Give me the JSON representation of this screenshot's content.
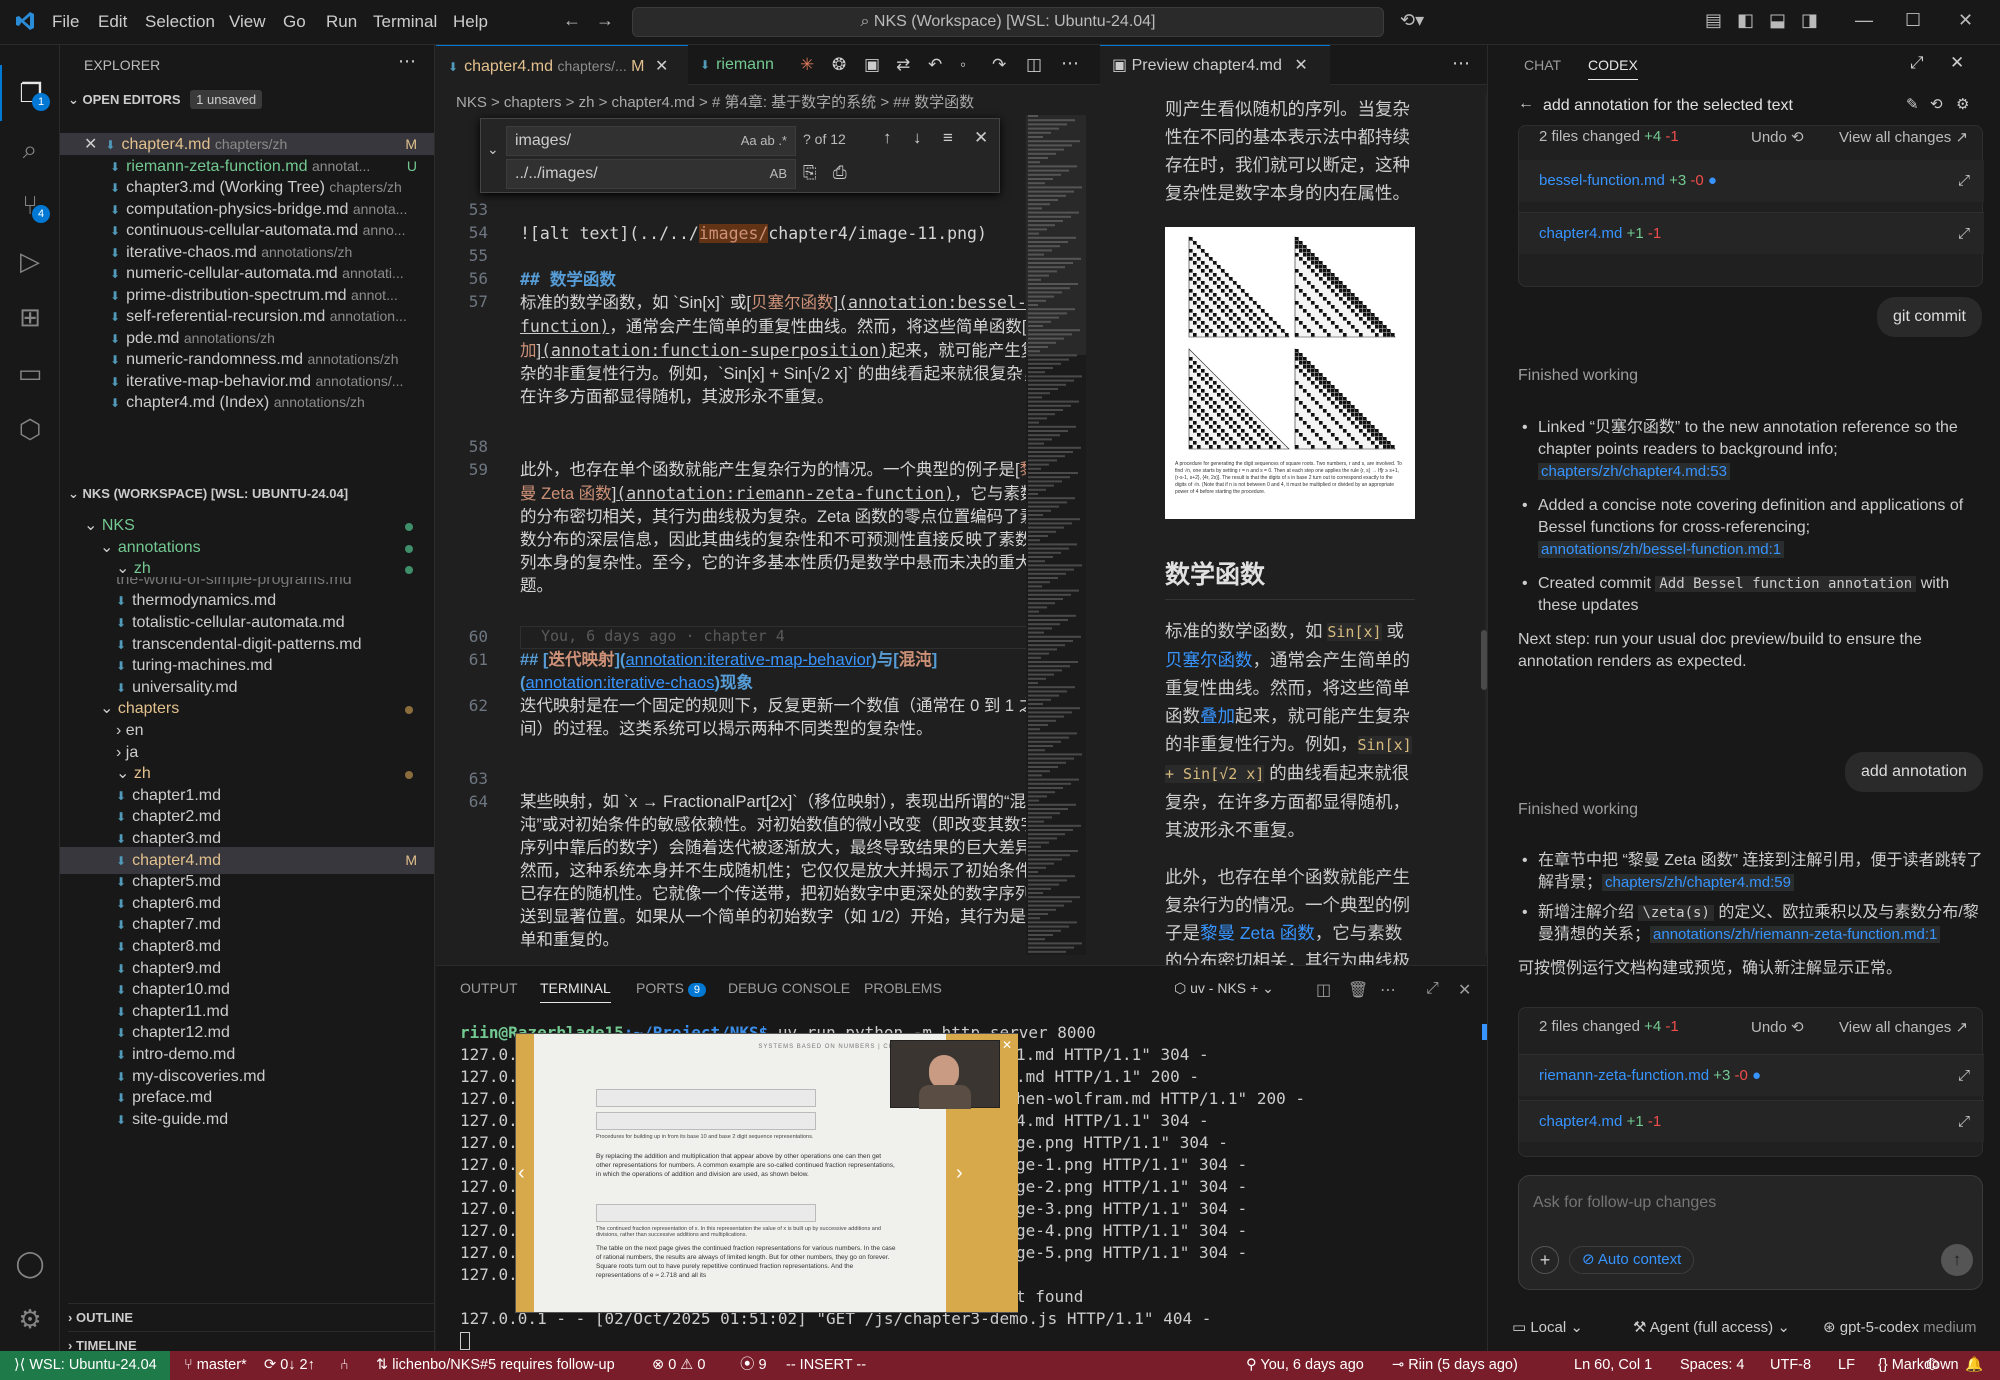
{
  "title_bar": {
    "menu": [
      "File",
      "Edit",
      "Selection",
      "View",
      "Go",
      "Run",
      "Terminal",
      "Help"
    ],
    "command_center": "NKS (Workspace) [WSL: Ubuntu-24.04]"
  },
  "activity_bar": {
    "explorer_badge": "1",
    "scm_badge": "4"
  },
  "explorer": {
    "title": "EXPLORER",
    "open_editors_label": "OPEN EDITORS",
    "unsaved_badge": "1 unsaved",
    "open_editors": [
      {
        "name": "chapter4.md",
        "desc": "chapters/zh",
        "status": "M"
      },
      {
        "name": "riemann-zeta-function.md",
        "desc": "annotat...",
        "status": "U"
      },
      {
        "name": "chapter3.md (Working Tree)",
        "desc": "chapters/zh",
        "status": ""
      },
      {
        "name": "computation-physics-bridge.md",
        "desc": "annota...",
        "status": ""
      },
      {
        "name": "continuous-cellular-automata.md",
        "desc": "anno...",
        "status": ""
      },
      {
        "name": "iterative-chaos.md",
        "desc": "annotations/zh",
        "status": ""
      },
      {
        "name": "numeric-cellular-automata.md",
        "desc": "annotati...",
        "status": ""
      },
      {
        "name": "prime-distribution-spectrum.md",
        "desc": "annot...",
        "status": ""
      },
      {
        "name": "self-referential-recursion.md",
        "desc": "annotation...",
        "status": ""
      },
      {
        "name": "pde.md",
        "desc": "annotations/zh",
        "status": ""
      },
      {
        "name": "numeric-randomness.md",
        "desc": "annotations/zh",
        "status": ""
      },
      {
        "name": "iterative-map-behavior.md",
        "desc": "annotations/...",
        "status": ""
      },
      {
        "name": "chapter4.md (Index)",
        "desc": "annotations/zh",
        "status": ""
      }
    ],
    "workspace_label": "NKS (WORKSPACE) [WSL: UBUNTU-24.04]",
    "tree_top": [
      {
        "name": "NKS",
        "indent": 1
      },
      {
        "name": "annotations",
        "indent": 2
      },
      {
        "name": "zh",
        "indent": 3
      }
    ],
    "cut_off": "the-world-of-simple-programs.md",
    "annotation_files": [
      "thermodynamics.md",
      "totalistic-cellular-automata.md",
      "transcendental-digit-patterns.md",
      "turing-machines.md",
      "universality.md"
    ],
    "chapters_label": "chapters",
    "lang_folders": [
      "en",
      "ja",
      "zh"
    ],
    "chapter_files": [
      "chapter1.md",
      "chapter2.md",
      "chapter3.md",
      "chapter4.md",
      "chapter5.md",
      "chapter6.md",
      "chapter7.md",
      "chapter8.md",
      "chapter9.md",
      "chapter10.md",
      "chapter11.md",
      "chapter12.md",
      "intro-demo.md",
      "my-discoveries.md",
      "preface.md",
      "site-guide.md"
    ],
    "chapter4_status": "M",
    "outline_label": "OUTLINE",
    "timeline_label": "TIMELINE"
  },
  "editor": {
    "tab1_name": "chapter4.md",
    "tab1_desc": "chapters/...",
    "tab1_status": "M",
    "tab2_name": "riemann",
    "breadcrumb": "NKS  >  chapters  >  zh  >  chapter4.md  >  # 第4章: 基于数字的系统  >  ## 数学函数",
    "find_value": "images/",
    "find_count": "? of 12",
    "replace_value": "../../images/",
    "line_numbers": [
      "53",
      "54",
      "55",
      "56",
      "57",
      "58",
      "59",
      "60",
      "61",
      "62",
      "63",
      "64"
    ],
    "line54_prefix": "![alt text](../../",
    "line54_match": "images/",
    "line54_suffix": "chapter4/image-11.png)",
    "line56_hash": "## ",
    "line56_title": "数学函数",
    "line57_a": "标准的数学函数，如 `Sin[x]` 或[",
    "line57_link": "贝塞尔函数",
    "line57_b": "]",
    "line57_ann1": "(annotation:bessel-function)",
    "line57_c": "，通常会产生简单的重复性曲线。然而，将这些简单函数[",
    "line57_link2": "叠加",
    "line57_d": "]",
    "line57_ann2": "(annotation:function-superposition)",
    "line57_e": "起来，就可能产生复杂的非重复性行为。例如，`Sin[x] + Sin[√2 x]` 的曲线看起来就很复杂，在许多方面都显得随机，其波形永不重复。",
    "line59_a": "此外，也存在单个函数就能产生复杂行为的情况。一个典型的例子是[",
    "line59_link": "黎曼 Zeta 函数",
    "line59_b": "]",
    "line59_ann": "(annotation:riemann-zeta-function)",
    "line59_c": "，它与素数的分布密切相关，其行为曲线极为复杂。Zeta 函数的零点位置编码了素数分布的深层信息，因此其曲线的复杂性和不可预测性直接反映了素数序列本身的复杂性。至今，它的许多基本性质仍是数学中悬而未决的重大难题。",
    "blame": "You, 6 days ago · chapter 4",
    "line61_a": "## [",
    "line61_t1": "迭代映射",
    "line61_b": "](",
    "line61_u1": "annotation:iterative-map-behavior",
    "line61_c": ")与[",
    "line61_t2": "混沌",
    "line61_d": "](",
    "line61_u2": "annotation:iterative-chaos",
    "line61_e": ")现象",
    "line62": "迭代映射是在一个固定的规则下，反复更新一个数值（通常在 0 到 1 之间）的过程。这类系统可以揭示两种不同类型的复杂性。",
    "line64": "某些映射，如 `x → FractionalPart[2x]`（移位映射），表现出所谓的“混沌”或对初始条件的敏感依赖性。对初始数值的微小改变（即改变其数字序列中靠后的数字）会随着迭代被逐渐放大，最终导致结果的巨大差异。然而，这种系统本身并不生成随机性；它仅仅是放大并揭示了初始条件中已存在的随机性。它就像一个传送带，把初始数字中更深处的数字序列输送到显著位置。如果从一个简单的初始数字（如 1/2）开始，其行为是简单和重复的。"
  },
  "preview": {
    "tab_name": "Preview chapter4.md",
    "para_top": "则产生看似随机的序列。当复杂性在不同的基本表示法中都持续存在时，我们就可以断定，这种复杂性是数字本身的内在属性。",
    "figure_caption": "A procedure for generating the digit sequences of square roots. Two numbers, r and s, are involved. To find √n, one starts by setting r = n and s = 0. Then at each step one applies the rule {r, s} → If[r ≥ s+1, {r-s-1, s+2}, {4r, 2s}]. The result is that the digits of s in base 2 turn out to correspond exactly to the digits of √n. (Note that if n is not between 0 and 4, it must be multiplied or divided by an appropriate power of 4 before starting the procedure.",
    "heading": "数学函数",
    "p1_a": "标准的数学函数，如 ",
    "p1_code1": "Sin[x]",
    "p1_b": " 或",
    "p1_link": "贝塞尔函数",
    "p1_c": "，通常会产生简单的重复性曲线。然而，将这些简单函数",
    "p1_link2": "叠加",
    "p1_d": "起来，就可能产生复杂的非重复性行为。例如，",
    "p1_code2": "Sin[x] + Sin[√2 x]",
    "p1_e": " 的曲线看起来就很复杂，在许多方面都显得随机，其波形永不重复。",
    "p2_a": "此外，也存在单个函数就能产生复杂行为的情况。一个典型的例子是",
    "p2_link": "黎曼 Zeta 函数",
    "p2_b": "，它与素数的分布密切相关，其行为曲线极"
  },
  "panel": {
    "tabs": [
      "OUTPUT",
      "TERMINAL",
      "PORTS",
      "DEBUG CONSOLE",
      "PROBLEMS"
    ],
    "ports_badge": "9",
    "terminal_name": "uv - NKS",
    "prompt_user": "riin@Razerblade15",
    "prompt_path": ":~/Project/NKS$",
    "prompt_cmd": " uv run python -m http.server 8000",
    "lines_left": [
      "127.0.",
      "127.0.",
      "127.0.",
      "127.0.",
      "127.0.",
      "127.0.",
      "127.0.",
      "127.0.",
      "127.0.",
      "127.0.",
      "127.0."
    ],
    "lines_right": [
      "1.md HTTP/1.1\" 304 -",
      ".md HTTP/1.1\" 200 -",
      "hen-wolfram.md HTTP/1.1\" 200 -",
      "4.md HTTP/1.1\" 304 -",
      "ge.png HTTP/1.1\" 304 -",
      "ge-1.png HTTP/1.1\" 304 -",
      "ge-2.png HTTP/1.1\" 304 -",
      "ge-3.png HTTP/1.1\" 304 -",
      "ge-4.png HTTP/1.1\" 304 -",
      "ge-5.png HTTP/1.1\" 304 -",
      ""
    ],
    "notfound": "t found",
    "last_line": "127.0.0.1 - - [02/Oct/2025 01:51:02] \"GET /js/chapter3-demo.js HTTP/1.1\" 404 -",
    "video_header": "SYSTEMS BASED ON NUMBERS  |  CHAPTER 4",
    "video_caption": "Procedures for building up in from its base 10 and base 2 digit sequence representations.",
    "video_p1": "By replacing the addition and multiplication that appear above by other operations one can then get other representations for numbers. A common example are so-called continued fraction representations, in which the operations of addition and division are used, as shown below.",
    "video_caption2": "The continued fraction representation of x. In this representation the value of x is built up by successive additions and divisions, rather than successive additions and multiplications.",
    "video_p2": "The table on the next page gives the continued fraction representations for various numbers. In the case of rational numbers, the results are always of limited length. But for other numbers, they go on forever. Square roots turn out to have purely repetitive continued fraction representations. And the representations of e ≈ 2.718 and all its"
  },
  "codex": {
    "tabs": [
      "CHAT",
      "CODEX"
    ],
    "task_title": "add annotation for the selected text",
    "changes1_summary": "2 files changed",
    "changes1_add": "+4",
    "changes1_del": "-1",
    "undo": "Undo",
    "view_all": "View all changes",
    "files1": [
      {
        "name": "bessel-function.md",
        "add": "+3",
        "del": "-0"
      },
      {
        "name": "chapter4.md",
        "add": "+1",
        "del": "-1"
      }
    ],
    "user_msg1": "git commit",
    "finished1": "Finished working",
    "bullet1_text": "Linked “贝塞尔函数” to the new annotation reference so the chapter points readers to background info;",
    "bullet1_ref": "chapters/zh/chapter4.md:53",
    "bullet2_text": "Added a concise note covering definition and applications of Bessel functions for cross-referencing;",
    "bullet2_ref": "annotations/zh/bessel-function.md:1",
    "bullet3_a": "Created commit ",
    "bullet3_code": "Add Bessel function annotation",
    "bullet3_b": " with these updates",
    "next_step": "Next step: run your usual doc preview/build to ensure the annotation renders as expected.",
    "user_msg2": "add annotation",
    "finished2": "Finished working",
    "zh_bullet1_text": "在章节中把 “黎曼 Zeta 函数” 连接到注解引用，便于读者跳转了解背景；",
    "zh_bullet1_ref": "chapters/zh/chapter4.md:59",
    "zh_bullet2_a": "新增注解介绍 ",
    "zh_bullet2_code": "\\zeta(s)",
    "zh_bullet2_b": " 的定义、欧拉乘积以及与素数分布/黎曼猜想的关系；",
    "zh_bullet2_ref": "annotations/zh/riemann-zeta-function.md:1",
    "zh_next": "可按惯例运行文档构建或预览，确认新注解显示正常。",
    "changes2_summary": "2 files changed",
    "changes2_add": "+4",
    "changes2_del": "-1",
    "files2": [
      {
        "name": "riemann-zeta-function.md",
        "add": "+3",
        "del": "-0"
      },
      {
        "name": "chapter4.md",
        "add": "+1",
        "del": "-1"
      }
    ],
    "input_placeholder": "Ask for follow-up changes",
    "auto_context": "Auto context",
    "env_local": "Local",
    "agent_mode": "Agent (full access)",
    "model": "gpt-5-codex",
    "model_effort": "medium"
  },
  "status_bar": {
    "remote": "WSL: Ubuntu-24.04",
    "branch": "master*",
    "sync": "0↓ 2↑",
    "pr": "lichenbo/NKS#5 requires follow-up",
    "errors": "0",
    "warnings": "0",
    "ports": "9",
    "mode": "-- INSERT --",
    "blame": "You, 6 days ago",
    "author": "Riin (5 days ago)",
    "cursor": "Ln 60, Col 1",
    "spaces": "Spaces: 4",
    "encoding": "UTF-8",
    "eol": "LF",
    "language": "Markdown"
  }
}
